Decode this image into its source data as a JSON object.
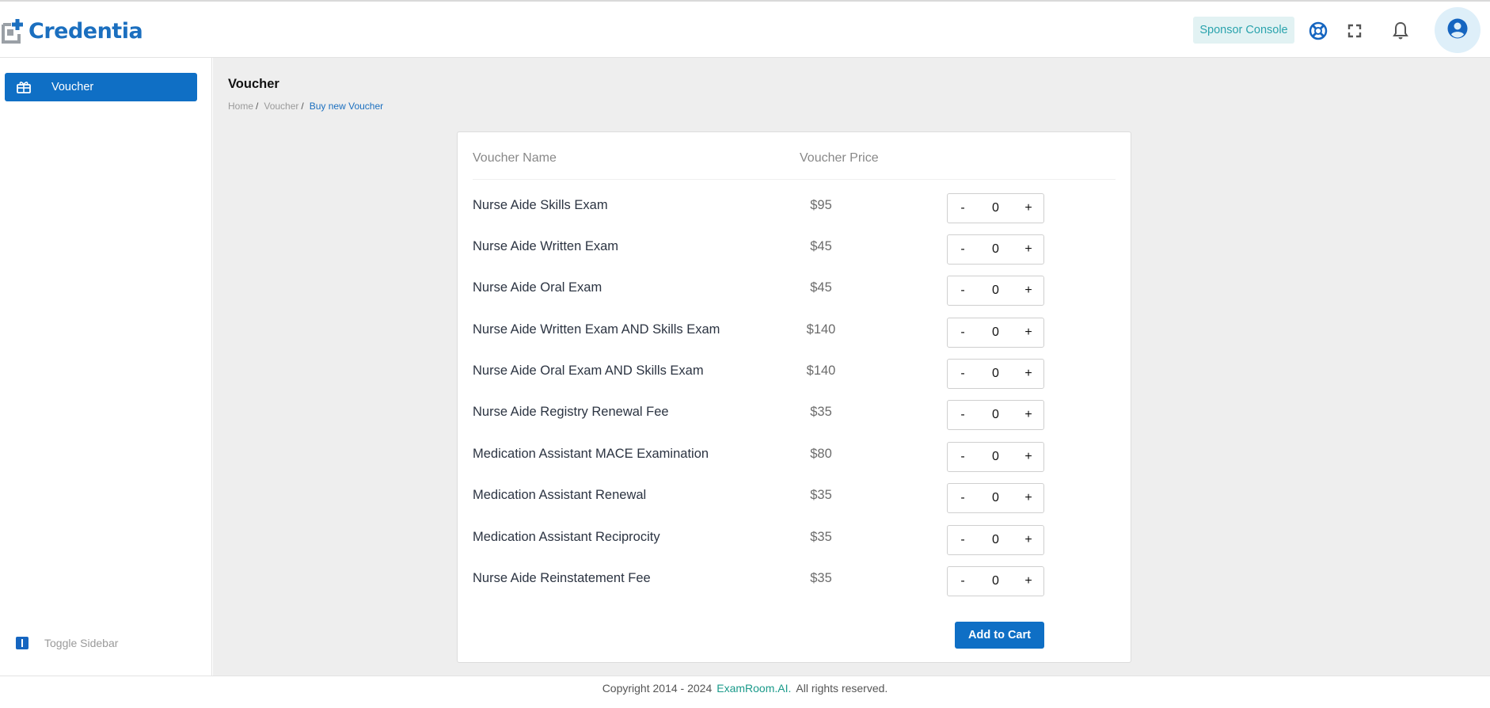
{
  "brand": {
    "logo_text": "Credentia"
  },
  "header": {
    "sponsor_console_label": "Sponsor Console",
    "icons": [
      "support-icon",
      "fullscreen-icon",
      "bell-icon",
      "user-avatar-icon"
    ]
  },
  "sidebar": {
    "items": [
      {
        "label": "Voucher",
        "icon": "voucher-icon",
        "active": true
      }
    ],
    "toggle_label": "Toggle Sidebar"
  },
  "page": {
    "title": "Voucher",
    "breadcrumb": [
      "Home",
      "Voucher",
      "Buy new Voucher"
    ]
  },
  "table": {
    "headers": {
      "name": "Voucher Name",
      "price": "Voucher Price"
    },
    "rows": [
      {
        "name": "Nurse Aide Skills Exam",
        "price": "$95",
        "qty": "0"
      },
      {
        "name": "Nurse Aide Written Exam",
        "price": "$45",
        "qty": "0"
      },
      {
        "name": "Nurse Aide Oral Exam",
        "price": "$45",
        "qty": "0"
      },
      {
        "name": "Nurse Aide Written Exam AND Skills Exam",
        "price": "$140",
        "qty": "0"
      },
      {
        "name": "Nurse Aide Oral Exam AND Skills Exam",
        "price": "$140",
        "qty": "0"
      },
      {
        "name": "Nurse Aide Registry Renewal Fee",
        "price": "$35",
        "qty": "0"
      },
      {
        "name": "Medication Assistant MACE Examination",
        "price": "$80",
        "qty": "0"
      },
      {
        "name": "Medication Assistant Renewal",
        "price": "$35",
        "qty": "0"
      },
      {
        "name": "Medication Assistant Reciprocity",
        "price": "$35",
        "qty": "0"
      },
      {
        "name": "Nurse Aide Reinstatement Fee",
        "price": "$35",
        "qty": "0"
      }
    ],
    "minus_label": "-",
    "plus_label": "+",
    "add_to_cart_label": "Add to Cart"
  },
  "footer": {
    "prefix": "Copyright 2014 - 2024",
    "brand": "ExamRoom.AI.",
    "suffix": "All rights reserved."
  },
  "colors": {
    "primary": "#0f6fc5",
    "sponsor_bg": "#e2f2f3",
    "sponsor_text": "#2aa3ad",
    "footer_link": "#1a9a8a"
  }
}
